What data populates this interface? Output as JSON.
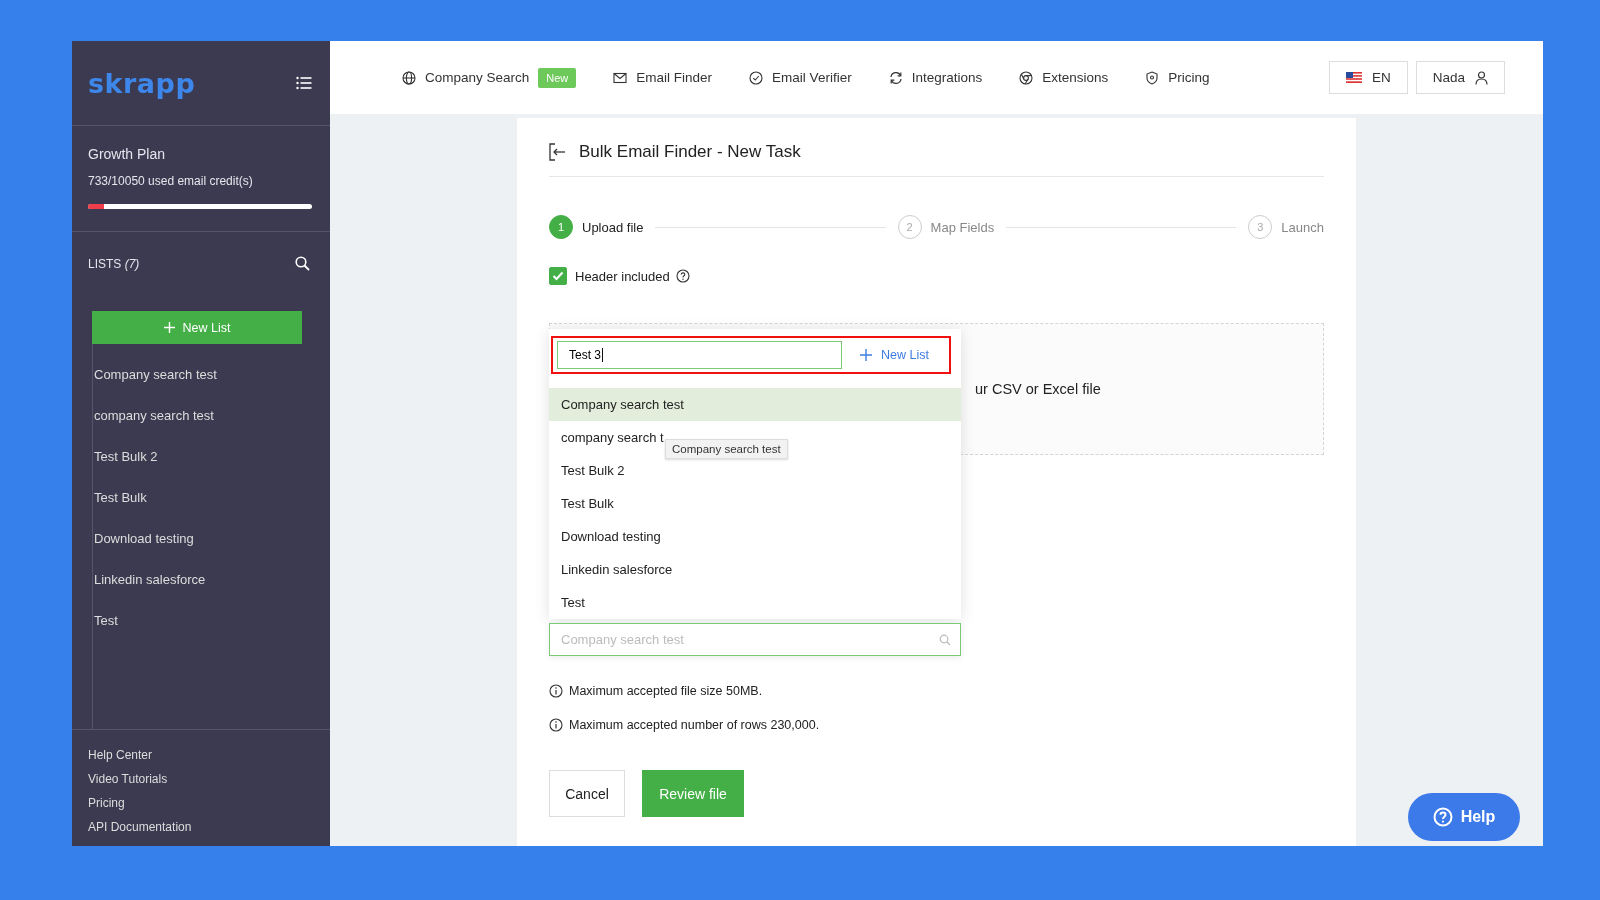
{
  "sidebar": {
    "logo": "skrapp",
    "plan": {
      "name": "Growth Plan",
      "credits": "733/10050 used email credit(s)",
      "level": 0.073
    },
    "lists": {
      "heading": "LISTS *(7)*",
      "new_button": "New List",
      "items": [
        {
          "label": "Company search test"
        },
        {
          "label": "company search test"
        },
        {
          "label": "Test Bulk 2"
        },
        {
          "label": "Test Bulk"
        },
        {
          "label": "Download testing"
        },
        {
          "label": "Linkedin salesforce"
        },
        {
          "label": "Test"
        }
      ]
    },
    "footer_links": [
      "Help Center",
      "Video Tutorials",
      "Pricing",
      "API Documentation"
    ]
  },
  "nav": {
    "items": [
      {
        "label": "Company Search",
        "badge": "New"
      },
      {
        "label": "Email Finder"
      },
      {
        "label": "Email Verifier"
      },
      {
        "label": "Integrations"
      },
      {
        "label": "Extensions"
      },
      {
        "label": "Pricing"
      }
    ],
    "language": "EN",
    "user": "Nada"
  },
  "page": {
    "title": "Bulk Email Finder - New Task",
    "steps": [
      {
        "number": "1",
        "label": "Upload file",
        "active": true
      },
      {
        "number": "2",
        "label": "Map Fields",
        "active": false
      },
      {
        "number": "3",
        "label": "Launch",
        "active": false
      }
    ],
    "header_included": {
      "label": "Header included",
      "checked": true
    },
    "dropzone_text": "ur CSV or Excel file",
    "list_select": {
      "placeholder": "Company search test",
      "dropdown": {
        "new_list_input": "Test 3",
        "new_list_button": "New List",
        "options": [
          {
            "label": "Company search test",
            "selected": true
          },
          {
            "label": "company search t",
            "selected": false
          },
          {
            "label": "Test Bulk 2",
            "selected": false
          },
          {
            "label": "Test Bulk",
            "selected": false
          },
          {
            "label": "Download testing",
            "selected": false
          },
          {
            "label": "Linkedin salesforce",
            "selected": false
          },
          {
            "label": "Test",
            "selected": false
          }
        ],
        "tooltip": "Company search test"
      }
    },
    "notes": [
      "Maximum accepted file size 50MB.",
      "Maximum accepted number of rows 230,000."
    ],
    "buttons": {
      "cancel": "Cancel",
      "submit": "Review file"
    }
  },
  "help_button": "Help"
}
